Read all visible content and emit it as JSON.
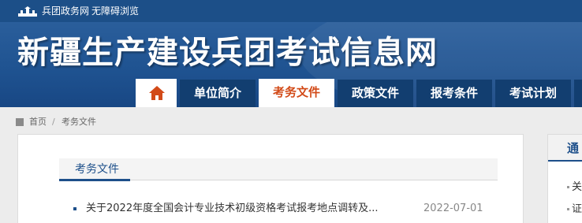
{
  "top_bar": {
    "links": [
      "兵团政务网",
      "无障碍浏览"
    ]
  },
  "banner": {
    "title": "新疆生产建设兵团考试信息网"
  },
  "nav": {
    "home_icon": "home-icon",
    "items": [
      "单位简介",
      "考务文件",
      "政策文件",
      "报考条件",
      "考试计划"
    ],
    "active": "考务文件"
  },
  "breadcrumb": {
    "home": "首页",
    "separator": "/",
    "current": "考务文件"
  },
  "main": {
    "section_title": "考务文件",
    "documents": [
      {
        "title": "关于2022年度全国会计专业技术初级资格考试报考地点调转及...",
        "date": "2022-07-01"
      }
    ]
  },
  "side": {
    "title": "通",
    "items": [
      "关",
      "证"
    ]
  },
  "colors": {
    "brand_blue": "#1c4f88",
    "nav_dark": "#123e70",
    "active_orange": "#d24a18"
  }
}
